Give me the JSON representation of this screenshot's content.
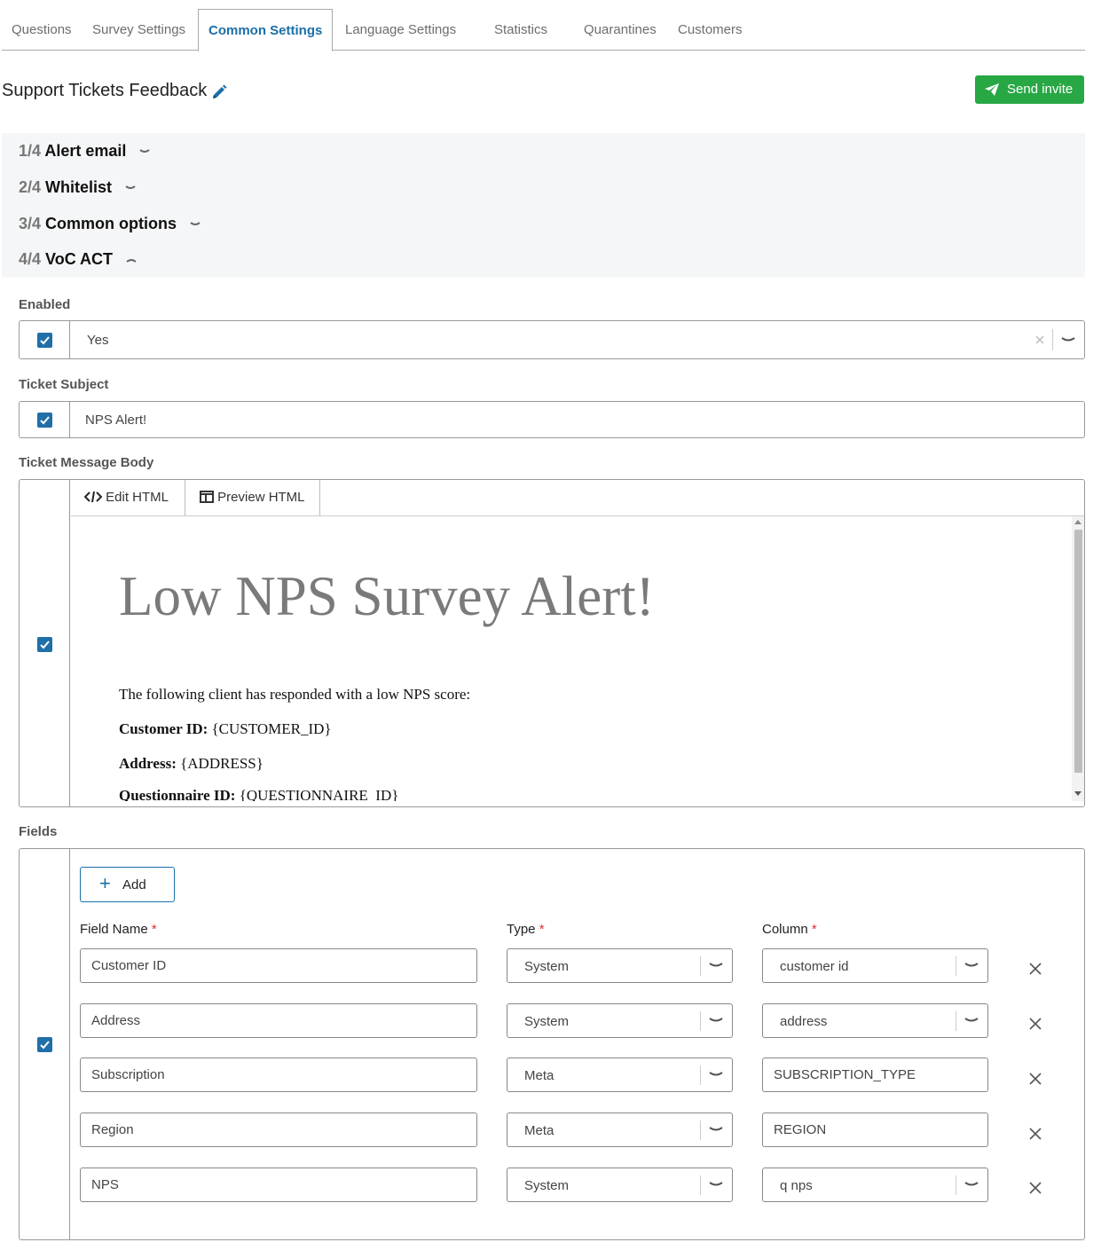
{
  "tabs": [
    "Questions",
    "Survey Settings",
    "Common Settings",
    "Language Settings",
    "Statistics",
    "Quarantines",
    "Customers"
  ],
  "active_tab": "Common Settings",
  "header": {
    "title": "Support Tickets Feedback",
    "send_label": "Send invite"
  },
  "accordion": [
    {
      "num": "1/4",
      "label": "Alert email",
      "expanded": false
    },
    {
      "num": "2/4",
      "label": "Whitelist",
      "expanded": false
    },
    {
      "num": "3/4",
      "label": "Common options",
      "expanded": false
    },
    {
      "num": "4/4",
      "label": "VoC ACT",
      "expanded": true
    }
  ],
  "enabled": {
    "label": "Enabled",
    "value": "Yes",
    "checked": true
  },
  "subject": {
    "label": "Ticket Subject",
    "value": "NPS Alert!",
    "checked": true
  },
  "body": {
    "label": "Ticket Message Body",
    "checked": true,
    "tabs": {
      "edit": "Edit HTML",
      "preview": "Preview HTML"
    },
    "heading": "Low NPS Survey Alert!",
    "intro": "The following client has responded with a low NPS score:",
    "lines": [
      {
        "key": "Customer ID:",
        "value": "{CUSTOMER_ID}"
      },
      {
        "key": "Address:",
        "value": "{ADDRESS}"
      },
      {
        "key": "Questionnaire ID:",
        "value": "{QUESTIONNAIRE_ID}"
      }
    ]
  },
  "fields": {
    "label": "Fields",
    "checked": true,
    "add_label": "Add",
    "headers": {
      "name": "Field Name",
      "type": "Type",
      "column": "Column"
    },
    "required_mark": "*",
    "rows": [
      {
        "name": "Customer ID",
        "type": "System",
        "column": "customer id",
        "column_is_select": true
      },
      {
        "name": "Address",
        "type": "System",
        "column": "address",
        "column_is_select": true
      },
      {
        "name": "Subscription",
        "type": "Meta",
        "column": "SUBSCRIPTION_TYPE",
        "column_is_select": false
      },
      {
        "name": "Region",
        "type": "Meta",
        "column": "REGION",
        "column_is_select": false
      },
      {
        "name": "NPS",
        "type": "System",
        "column": "q nps",
        "column_is_select": true
      }
    ]
  },
  "colors": {
    "accent": "#1a6fa8",
    "success": "#28a745",
    "required": "#d33333"
  }
}
